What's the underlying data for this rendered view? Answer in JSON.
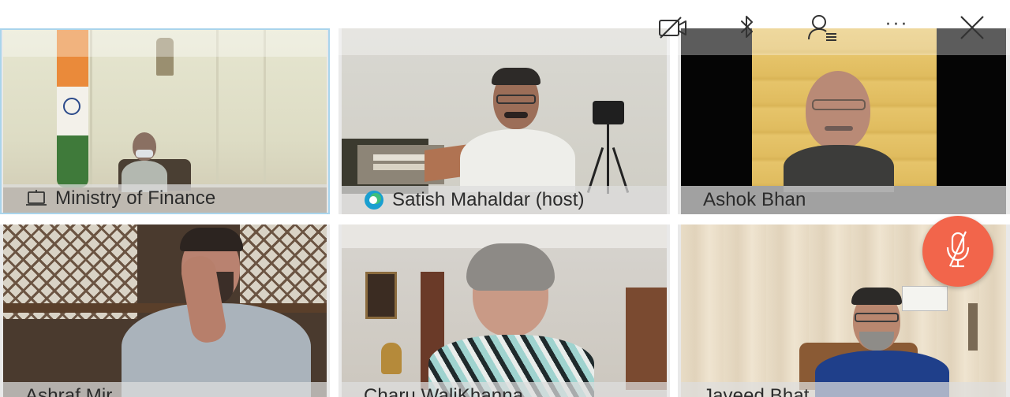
{
  "toolbar": {
    "video_icon": "video-off-icon",
    "bluetooth_icon": "bluetooth-icon",
    "participants_icon": "participants-icon",
    "more_label": "···",
    "close_icon": "close-icon"
  },
  "participants": [
    {
      "name": "Ministry of Finance",
      "icon": "laptop-icon",
      "active": true
    },
    {
      "name": "Satish Mahaldar (host)",
      "icon": "host-badge-icon",
      "active": false
    },
    {
      "name": "Ashok Bhan",
      "icon": "",
      "active": false
    },
    {
      "name": "Ashraf Mir",
      "icon": "",
      "active": false
    },
    {
      "name": "Charu WaliKhanna",
      "icon": "",
      "active": false
    },
    {
      "name": "Javeed Bhat",
      "icon": "",
      "active": false
    }
  ],
  "mute_button": {
    "icon": "microphone-muted-icon",
    "color": "#f2654b"
  },
  "colors": {
    "active_border": "#a9d4ec",
    "host_badge": "#1a9fd0",
    "name_bar": "#dedede"
  }
}
